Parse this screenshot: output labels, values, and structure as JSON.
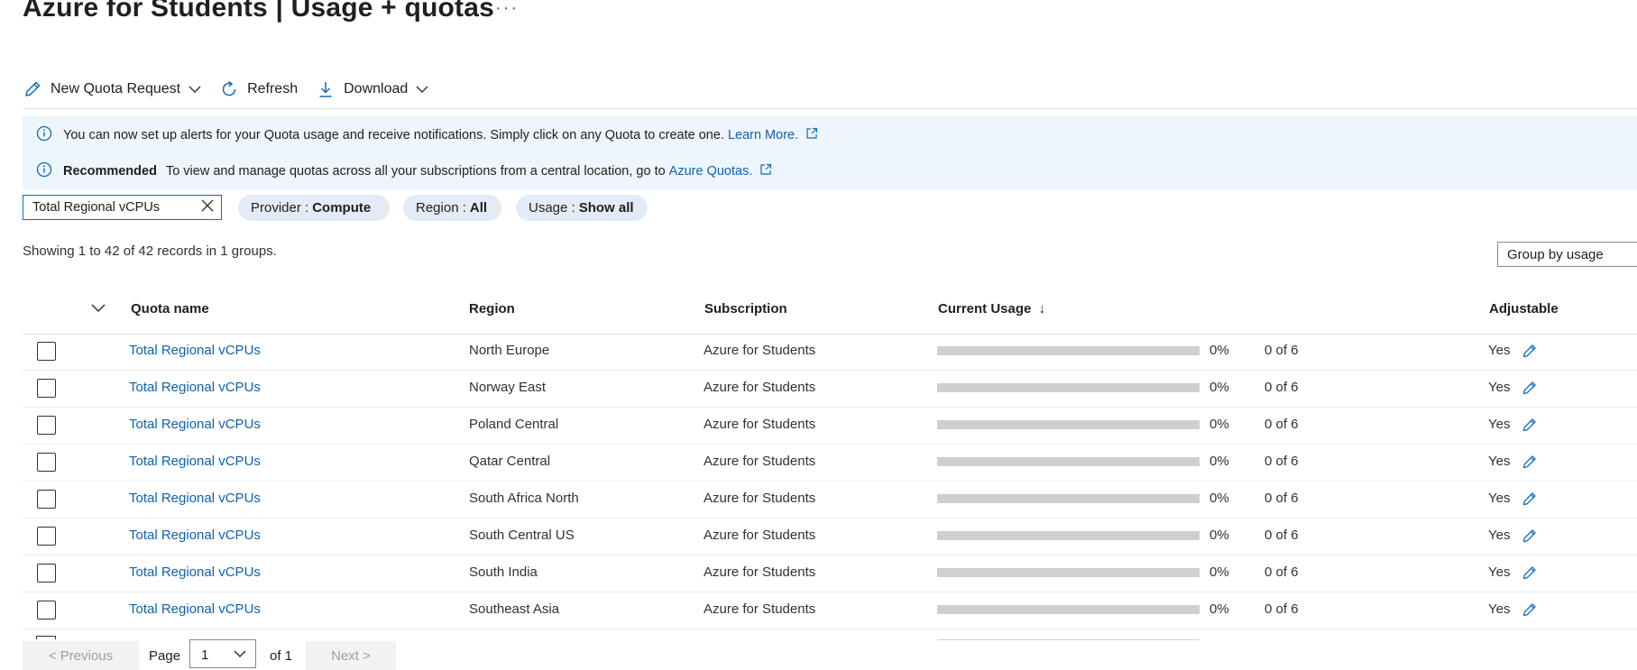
{
  "page": {
    "title": "Azure for Students | Usage + quotas",
    "more_label": "···"
  },
  "toolbar": {
    "new_request": "New Quota Request",
    "refresh": "Refresh",
    "download": "Download"
  },
  "banner": {
    "line1_text": "You can now set up alerts for your Quota usage and receive notifications. Simply click on any Quota to create one.",
    "line1_link": "Learn More.",
    "line2_bold": "Recommended",
    "line2_text": "To view and manage quotas across all your subscriptions from a central location, go to",
    "line2_link": "Azure Quotas."
  },
  "filters": {
    "search_value": "Total Regional vCPUs",
    "provider_label": "Provider :",
    "provider_value": "Compute",
    "region_label": "Region :",
    "region_value": "All",
    "usage_label": "Usage :",
    "usage_value": "Show all"
  },
  "summary": "Showing 1 to 42 of 42 records in 1 groups.",
  "group_by": "Group by usage",
  "table": {
    "columns": {
      "quota_name": "Quota name",
      "region": "Region",
      "subscription": "Subscription",
      "current_usage": "Current Usage",
      "sort_indicator": "↓",
      "adjustable": "Adjustable"
    },
    "rows": [
      {
        "quota": "Total Regional vCPUs",
        "region": "North Europe",
        "subscription": "Azure for Students",
        "percent": "0%",
        "usage": "0 of 6",
        "adjustable": "Yes",
        "fill": 0
      },
      {
        "quota": "Total Regional vCPUs",
        "region": "Norway East",
        "subscription": "Azure for Students",
        "percent": "0%",
        "usage": "0 of 6",
        "adjustable": "Yes",
        "fill": 0
      },
      {
        "quota": "Total Regional vCPUs",
        "region": "Poland Central",
        "subscription": "Azure for Students",
        "percent": "0%",
        "usage": "0 of 6",
        "adjustable": "Yes",
        "fill": 0
      },
      {
        "quota": "Total Regional vCPUs",
        "region": "Qatar Central",
        "subscription": "Azure for Students",
        "percent": "0%",
        "usage": "0 of 6",
        "adjustable": "Yes",
        "fill": 0
      },
      {
        "quota": "Total Regional vCPUs",
        "region": "South Africa North",
        "subscription": "Azure for Students",
        "percent": "0%",
        "usage": "0 of 6",
        "adjustable": "Yes",
        "fill": 0
      },
      {
        "quota": "Total Regional vCPUs",
        "region": "South Central US",
        "subscription": "Azure for Students",
        "percent": "0%",
        "usage": "0 of 6",
        "adjustable": "Yes",
        "fill": 0
      },
      {
        "quota": "Total Regional vCPUs",
        "region": "South India",
        "subscription": "Azure for Students",
        "percent": "0%",
        "usage": "0 of 6",
        "adjustable": "Yes",
        "fill": 0
      },
      {
        "quota": "Total Regional vCPUs",
        "region": "Southeast Asia",
        "subscription": "Azure for Students",
        "percent": "0%",
        "usage": "0 of 6",
        "adjustable": "Yes",
        "fill": 0
      }
    ]
  },
  "pagination": {
    "previous": "< Previous",
    "page_label": "Page",
    "page_value": "1",
    "of_label": "of 1",
    "next": "Next >"
  },
  "colors": {
    "accent": "#0f6cbd",
    "link": "#0f62ad",
    "banner_bg": "#eef5fc",
    "pill_bg": "#e3ecf6",
    "bar_track": "#cfcfcf"
  },
  "icons": {
    "new_request": "pencil-icon",
    "refresh": "refresh-icon",
    "download": "download-icon",
    "info": "info-icon",
    "external": "external-link-icon",
    "clear": "close-icon",
    "edit": "pencil-icon"
  }
}
